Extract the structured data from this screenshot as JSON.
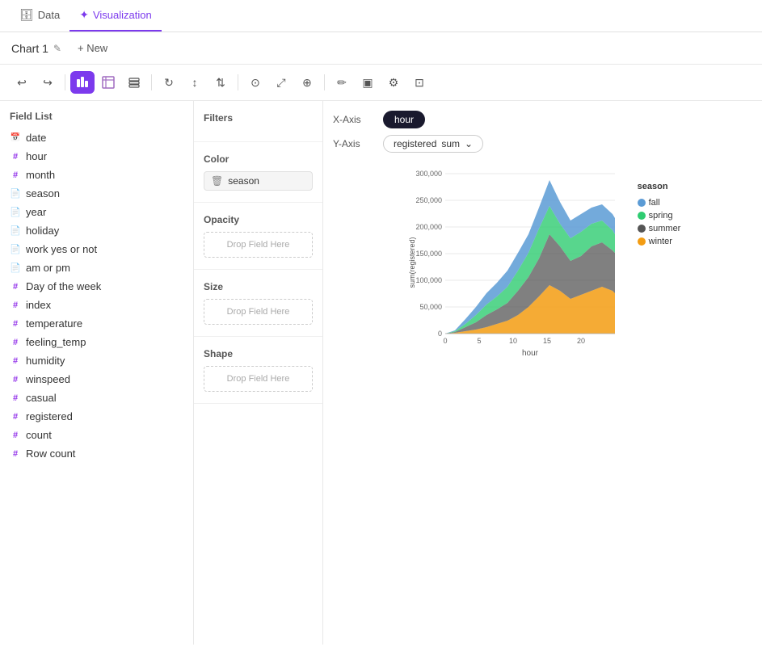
{
  "nav": {
    "tabs": [
      {
        "id": "data",
        "label": "Data",
        "icon": "🗄",
        "active": false
      },
      {
        "id": "visualization",
        "label": "Visualization",
        "icon": "✦",
        "active": true
      }
    ]
  },
  "chartTitleBar": {
    "title": "Chart 1",
    "editLabel": "✎",
    "newLabel": "+ New"
  },
  "toolbar": {
    "buttons": [
      {
        "id": "undo",
        "icon": "↩",
        "active": false
      },
      {
        "id": "redo",
        "icon": "↪",
        "active": false
      },
      {
        "id": "chart-type",
        "icon": "◉",
        "active": true
      },
      {
        "id": "table",
        "icon": "◧",
        "active": false
      },
      {
        "id": "layers",
        "icon": "⊞",
        "active": false
      },
      {
        "id": "refresh",
        "icon": "↻",
        "active": false
      },
      {
        "id": "sort-asc",
        "icon": "↕",
        "active": false
      },
      {
        "id": "sort-desc",
        "icon": "⇅",
        "active": false
      },
      {
        "id": "align",
        "icon": "⊙",
        "active": false
      },
      {
        "id": "expand",
        "icon": "⤢",
        "active": false
      },
      {
        "id": "paint",
        "icon": "⊕",
        "active": false
      },
      {
        "id": "brush",
        "icon": "✏",
        "active": false
      },
      {
        "id": "image",
        "icon": "▣",
        "active": false
      },
      {
        "id": "settings",
        "icon": "⚙",
        "active": false
      },
      {
        "id": "export",
        "icon": "⊡",
        "active": false
      }
    ]
  },
  "fieldList": {
    "title": "Field List",
    "fields": [
      {
        "name": "date",
        "type": "date",
        "symbol": "📅"
      },
      {
        "name": "hour",
        "type": "hash"
      },
      {
        "name": "month",
        "type": "hash"
      },
      {
        "name": "season",
        "type": "text",
        "symbol": "📄"
      },
      {
        "name": "year",
        "type": "text",
        "symbol": "📄"
      },
      {
        "name": "holiday",
        "type": "text",
        "symbol": "📄"
      },
      {
        "name": "work yes or not",
        "type": "text",
        "symbol": "📄"
      },
      {
        "name": "am or pm",
        "type": "text",
        "symbol": "📄"
      },
      {
        "name": "Day of the week",
        "type": "hash"
      },
      {
        "name": "index",
        "type": "hash"
      },
      {
        "name": "temperature",
        "type": "hash"
      },
      {
        "name": "feeling_temp",
        "type": "hash"
      },
      {
        "name": "humidity",
        "type": "hash"
      },
      {
        "name": "winspeed",
        "type": "hash"
      },
      {
        "name": "casual",
        "type": "hash"
      },
      {
        "name": "registered",
        "type": "hash"
      },
      {
        "name": "count",
        "type": "hash"
      },
      {
        "name": "Row count",
        "type": "hash"
      }
    ]
  },
  "configPanel": {
    "filters": {
      "title": "Filters",
      "dropLabel": ""
    },
    "color": {
      "title": "Color",
      "field": "season"
    },
    "opacity": {
      "title": "Opacity",
      "dropLabel": "Drop Field Here"
    },
    "size": {
      "title": "Size",
      "dropLabel": "Drop Field Here"
    },
    "shape": {
      "title": "Shape",
      "dropLabel": "Drop Field Here"
    }
  },
  "axes": {
    "xLabel": "X-Axis",
    "xField": "hour",
    "yLabel": "Y-Axis",
    "yField": "registered",
    "yAgg": "sum"
  },
  "chart": {
    "title": "",
    "xAxisLabel": "hour",
    "yAxisLabel": "sum(registered)",
    "yMax": 300000,
    "yTicks": [
      0,
      50000,
      100000,
      150000,
      200000,
      250000,
      300000
    ],
    "xTicks": [
      0,
      5,
      10,
      15,
      20
    ],
    "legend": {
      "title": "season",
      "items": [
        {
          "label": "fall",
          "color": "#5b9bd5"
        },
        {
          "label": "spring",
          "color": "#2ecc71"
        },
        {
          "label": "summer",
          "color": "#555"
        },
        {
          "label": "winter",
          "color": "#f39c12"
        }
      ]
    }
  }
}
